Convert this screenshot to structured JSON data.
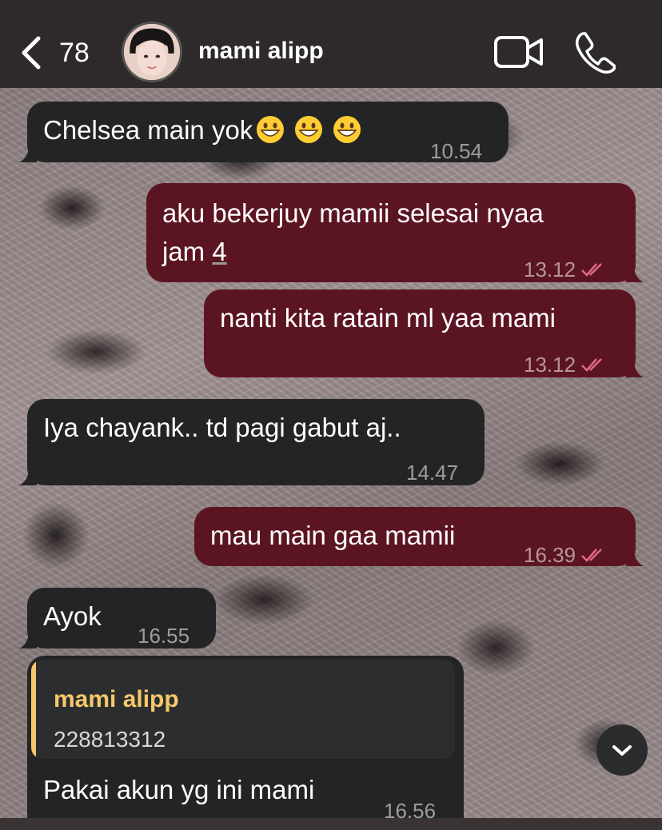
{
  "header": {
    "back_count": "78",
    "contact_name": "mami alipp"
  },
  "messages": [
    {
      "direction": "in",
      "text": "Chelsea main yok",
      "emoji": "grinning-face-emoji",
      "time": "10.54"
    },
    {
      "direction": "out",
      "line1": "aku bekerjuy mamii selesai nyaa",
      "line2_prefix": "jam ",
      "line2_link": "4",
      "time": "13.12",
      "status": "read"
    },
    {
      "direction": "out",
      "text": "nanti kita ratain ml yaa mami",
      "time": "13.12",
      "status": "read"
    },
    {
      "direction": "in",
      "text": "Iya chayank.. td pagi gabut aj..",
      "time": "14.47"
    },
    {
      "direction": "out",
      "text": "mau main gaa mamii",
      "time": "16.39",
      "status": "read"
    },
    {
      "direction": "in",
      "text": "Ayok",
      "time": "16.55"
    },
    {
      "direction": "in",
      "reply_to": {
        "name": "mami alipp",
        "text": "228813312"
      },
      "text": "Pakai akun yg ini mami",
      "time": "16.56"
    }
  ],
  "colors": {
    "header_bg": "#2e2a2a",
    "incoming_bubble": "#232425",
    "outgoing_bubble": "#5b1522",
    "read_ticks": "#e06a85",
    "reply_accent": "#f4c76b"
  },
  "icons": {
    "back": "chevron-left-icon",
    "video": "video-camera-icon",
    "call": "phone-icon",
    "scroll": "chevron-down-icon"
  }
}
